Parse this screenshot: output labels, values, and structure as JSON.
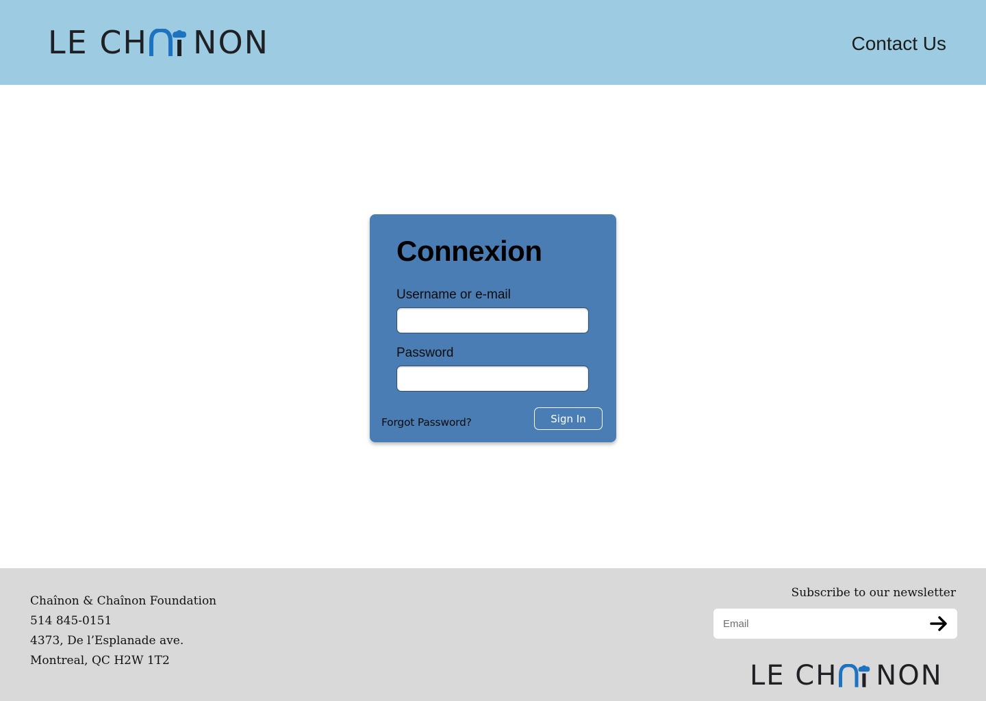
{
  "header": {
    "logo": {
      "left": "LE CH",
      "right": "NON"
    },
    "contact_label": "Contact Us"
  },
  "login": {
    "title": "Connexion",
    "username_label": "Username or e-mail",
    "username_value": "",
    "password_label": "Password",
    "password_value": "",
    "forgot_label": "Forgot Password?",
    "signin_label": "Sign In"
  },
  "footer": {
    "address_lines": [
      "Chaînon & Chaînon Foundation",
      "514 845-0151",
      "4373, De l’Esplanade ave.",
      "Montreal, QC H2W 1T2"
    ],
    "newsletter_title": "Subscribe to our newsletter",
    "newsletter_placeholder": "Email",
    "submit_icon": "arrow-right-icon",
    "logo": {
      "left": "LE CH",
      "right": "NON"
    }
  },
  "colors": {
    "header_bg": "#9ccbe2",
    "card_bg": "#4a7db4",
    "logo_accent": "#1e73c0",
    "footer_bg": "#d9d9d9"
  }
}
